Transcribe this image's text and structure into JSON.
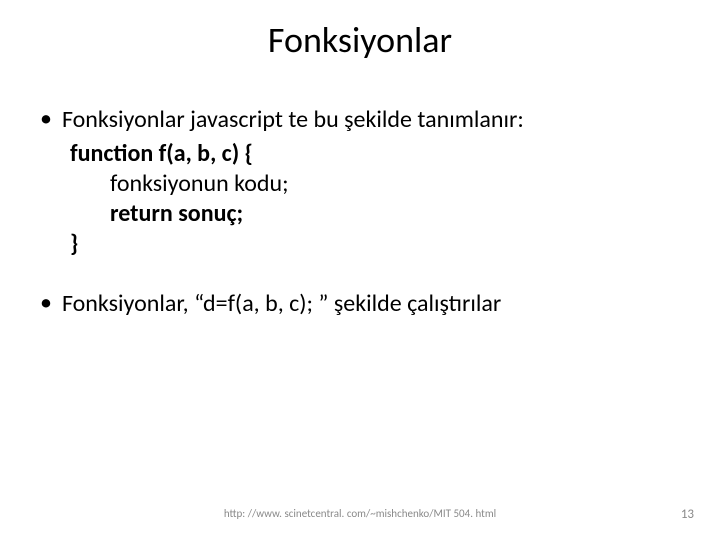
{
  "title": "Fonksiyonlar",
  "bullets": {
    "b1": "Fonksiyonlar javascript te bu şekilde tanımlanır:",
    "b2": "Fonksiyonlar, “d=f(a, b, c); ” şekilde çalıştırılar"
  },
  "code": {
    "line1": "function f(a, b, c) {",
    "line2": "fonksiyonun kodu;",
    "line3": "return sonuç;",
    "line4": "}"
  },
  "footer": {
    "url": "http: //www. scinetcentral. com/~mishchenko/MIT 504. html",
    "page": "13"
  },
  "glyphs": {
    "bullet": "•"
  }
}
